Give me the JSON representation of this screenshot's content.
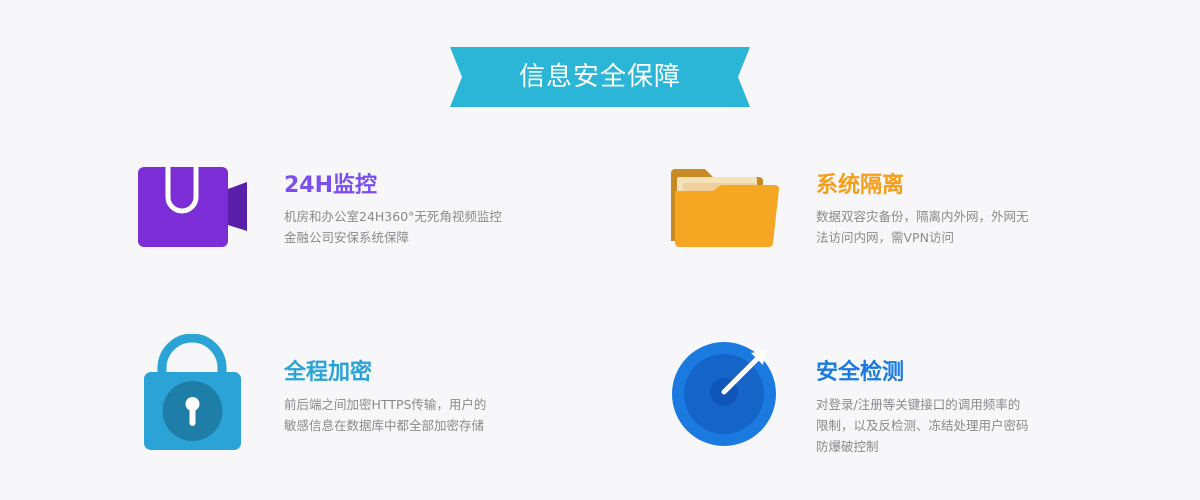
{
  "banner": {
    "title": "信息安全保障",
    "color": "#2bb5d6"
  },
  "features": [
    {
      "key": "monitor",
      "title": "24H监控",
      "title_color": "#7b4ff0",
      "icon": "video-camera-icon",
      "desc_lines": [
        "机房和办公室24H360°无死角视频监控",
        "金融公司安保系统保障"
      ]
    },
    {
      "key": "isolation",
      "title": "系统隔离",
      "title_color": "#f59e1c",
      "icon": "folder-icon",
      "desc_lines": [
        "数据双容灾备份，隔离内外网，外网无",
        "法访问内网，需VPN访问"
      ]
    },
    {
      "key": "encryption",
      "title": "全程加密",
      "title_color": "#2ca3d6",
      "icon": "padlock-icon",
      "desc_lines": [
        "前后端之间加密HTTPS传输，用户的",
        "敏感信息在数据库中都全部加密存储"
      ]
    },
    {
      "key": "detection",
      "title": "安全检测",
      "title_color": "#1a7ae0",
      "icon": "target-icon",
      "desc_lines": [
        "对登录/注册等关键接口的调用频率的",
        "限制，以及反检测、冻结处理用户密码",
        "防爆破控制"
      ]
    }
  ]
}
